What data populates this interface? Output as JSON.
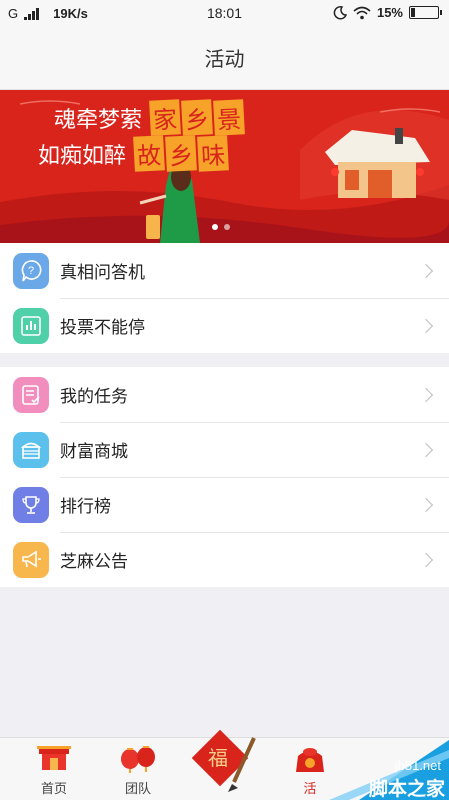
{
  "status_bar": {
    "network_type": "G",
    "speed": "19K/s",
    "time": "18:01",
    "battery": "15%",
    "battery_level": 0.15,
    "icons": [
      "signal-icon",
      "moon-icon",
      "wifi-icon",
      "battery-icon"
    ]
  },
  "header": {
    "title": "活动"
  },
  "banner": {
    "line1_prefix": "魂牵梦萦",
    "line1_highlight": [
      "家",
      "乡",
      "景"
    ],
    "line2_prefix": "如痴如醉",
    "line2_highlight": [
      "故",
      "乡",
      "味"
    ],
    "slides": 2,
    "active_slide": 0
  },
  "group1": [
    {
      "label": "真相问答机",
      "icon": "question-icon",
      "color": "#6aa8e8"
    },
    {
      "label": "投票不能停",
      "icon": "chart-icon",
      "color": "#4fd0a9"
    }
  ],
  "group2": [
    {
      "label": "我的任务",
      "icon": "task-list-icon",
      "color": "#f28ebd"
    },
    {
      "label": "财富商城",
      "icon": "store-icon",
      "color": "#5bc0ec"
    },
    {
      "label": "排行榜",
      "icon": "trophy-icon",
      "color": "#6f7fe6"
    },
    {
      "label": "芝麻公告",
      "icon": "megaphone-icon",
      "color": "#f7b74d"
    }
  ],
  "tabbar": {
    "tabs": [
      {
        "label": "首页",
        "icon": "home-temple-icon"
      },
      {
        "label": "团队",
        "icon": "team-lantern-icon"
      },
      {
        "label": "",
        "icon": "center-brush-icon"
      },
      {
        "label": "活",
        "icon": "activity-lucky-bag-icon",
        "active": true
      }
    ]
  },
  "watermark": {
    "url": "jb51.net",
    "name": "脚本之家"
  },
  "colors": {
    "accent": "#d9241c",
    "banner_highlight": "#f7a32a"
  }
}
